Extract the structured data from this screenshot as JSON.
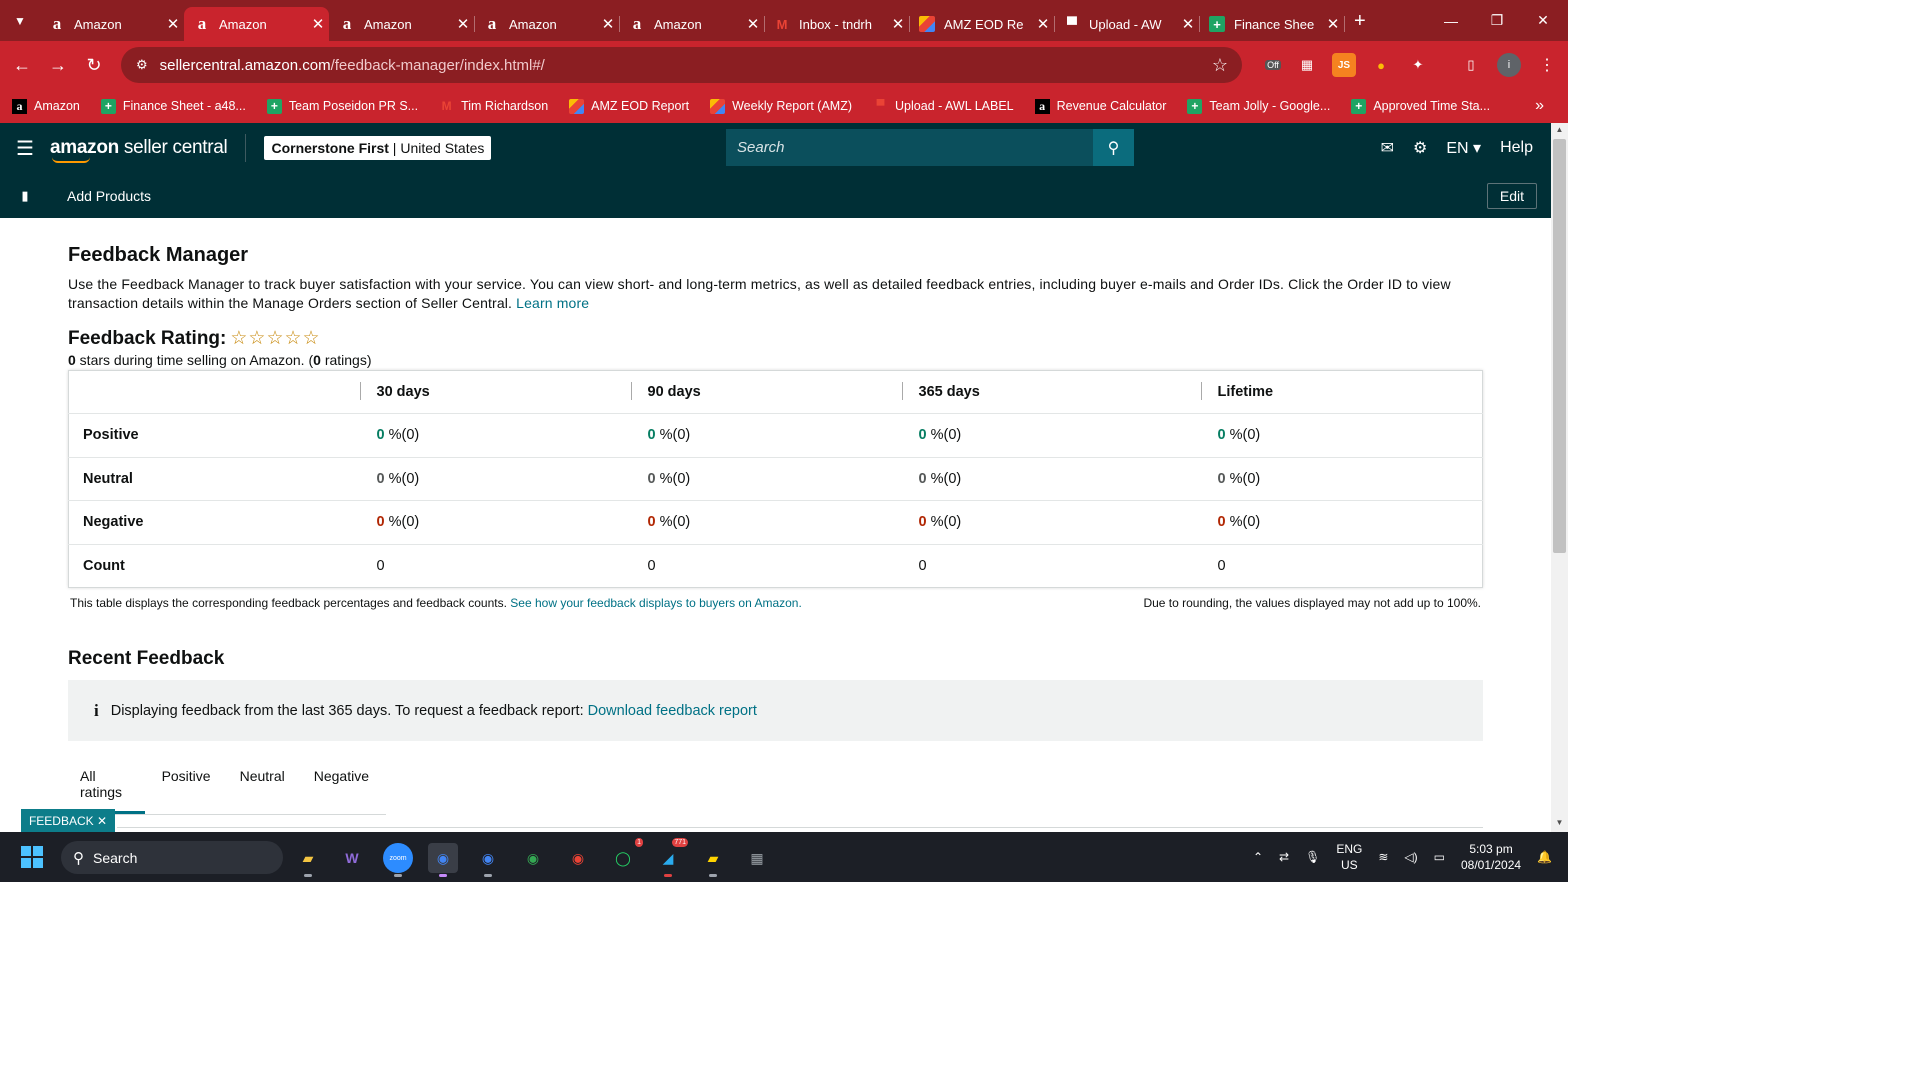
{
  "browser": {
    "tabs": [
      {
        "title": "Amazon",
        "icon": "amazon-icon",
        "active": false
      },
      {
        "title": "Amazon",
        "icon": "amazon-icon",
        "active": true
      },
      {
        "title": "Amazon",
        "icon": "amazon-icon",
        "active": false
      },
      {
        "title": "Amazon",
        "icon": "amazon-icon",
        "active": false
      },
      {
        "title": "Amazon",
        "icon": "amazon-icon",
        "active": false
      },
      {
        "title": "Inbox - tndrh",
        "icon": "gmail-icon",
        "active": false
      },
      {
        "title": "AMZ EOD Re",
        "icon": "colorful-icon",
        "active": false
      },
      {
        "title": "Upload - AW",
        "icon": "flag-icon",
        "active": false
      },
      {
        "title": "Finance Shee",
        "icon": "sheets-icon",
        "active": false
      }
    ],
    "url_host": "sellercentral.amazon.com",
    "url_path": "/feedback-manager/index.html#/",
    "bookmarks": [
      {
        "label": "Amazon",
        "icon": "amazon-icon"
      },
      {
        "label": "Finance Sheet - a48...",
        "icon": "sheets-icon"
      },
      {
        "label": "Team Poseidon PR S...",
        "icon": "sheets-icon"
      },
      {
        "label": "Tim Richardson",
        "icon": "gmail-icon"
      },
      {
        "label": "AMZ EOD Report",
        "icon": "colorful-icon"
      },
      {
        "label": "Weekly Report (AMZ)",
        "icon": "colorful-icon"
      },
      {
        "label": "Upload - AWL LABEL",
        "icon": "flag-icon"
      },
      {
        "label": "Revenue Calculator",
        "icon": "amazon-icon"
      },
      {
        "label": "Team Jolly - Google...",
        "icon": "sheets-icon"
      },
      {
        "label": "Approved Time Sta...",
        "icon": "sheets-icon"
      }
    ],
    "extension_off_label": "Off"
  },
  "header": {
    "logo_bold": "amazon",
    "logo_rest": " seller central",
    "store_name": "Cornerstone First",
    "store_region": "United States",
    "search_placeholder": "Search",
    "lang": "EN",
    "help": "Help",
    "sub_link": "Add Products",
    "edit": "Edit"
  },
  "page": {
    "title": "Feedback Manager",
    "description": "Use the Feedback Manager to track buyer satisfaction with your service. You can view short- and long-term metrics, as well as detailed feedback entries, including buyer e-mails and Order IDs. Click the Order ID to view transaction details within the Manage Orders section of Seller Central.",
    "learn_more": "Learn more",
    "rating_title": "Feedback Rating:",
    "stars": "☆☆☆☆☆",
    "rating_stars_value": "0",
    "rating_mid": " stars during time selling on Amazon. (",
    "rating_count": "0",
    "rating_end": " ratings)",
    "table": {
      "columns": [
        "30 days",
        "90 days",
        "365 days",
        "Lifetime"
      ],
      "rows": [
        {
          "label": "Positive",
          "kind": "g",
          "cells": [
            {
              "num": "0",
              "rest": " %(0)"
            },
            {
              "num": "0",
              "rest": " %(0)"
            },
            {
              "num": "0",
              "rest": " %(0)"
            },
            {
              "num": "0",
              "rest": " %(0)"
            }
          ]
        },
        {
          "label": "Neutral",
          "kind": "n",
          "cells": [
            {
              "num": "0",
              "rest": " %(0)"
            },
            {
              "num": "0",
              "rest": " %(0)"
            },
            {
              "num": "0",
              "rest": " %(0)"
            },
            {
              "num": "0",
              "rest": " %(0)"
            }
          ]
        },
        {
          "label": "Negative",
          "kind": "r",
          "cells": [
            {
              "num": "0",
              "rest": " %(0)"
            },
            {
              "num": "0",
              "rest": " %(0)"
            },
            {
              "num": "0",
              "rest": " %(0)"
            },
            {
              "num": "0",
              "rest": " %(0)"
            }
          ]
        },
        {
          "label": "Count",
          "kind": "plain",
          "cells": [
            {
              "num": "",
              "rest": "0"
            },
            {
              "num": "",
              "rest": "0"
            },
            {
              "num": "",
              "rest": "0"
            },
            {
              "num": "",
              "rest": "0"
            }
          ]
        }
      ]
    },
    "table_note": "This table displays the corresponding feedback percentages and feedback counts.",
    "table_note_link": "See how your feedback displays to buyers on Amazon.",
    "rounding_note": "Due to rounding, the values displayed may not add up to 100%.",
    "recent_title": "Recent Feedback",
    "info_icon": "i",
    "info_text": "Displaying feedback from the last 365 days. To request a feedback report:",
    "info_link": "Download feedback report",
    "filter_tabs": [
      "All ratings",
      "Positive",
      "Neutral",
      "Negative"
    ],
    "feedback_tag": "FEEDBACK ✕"
  },
  "taskbar": {
    "search": "Search",
    "lang_top": "ENG",
    "lang_bottom": "US",
    "time": "5:03 pm",
    "date": "08/01/2024",
    "whatsapp_badge": "1",
    "telegram_badge": "771"
  },
  "colors": {
    "chrome_dark": "#8b1e22",
    "chrome_red": "#c9242d",
    "seller_header": "#002f36",
    "link": "#007185",
    "positive": "#067d62",
    "negative": "#b12704"
  }
}
